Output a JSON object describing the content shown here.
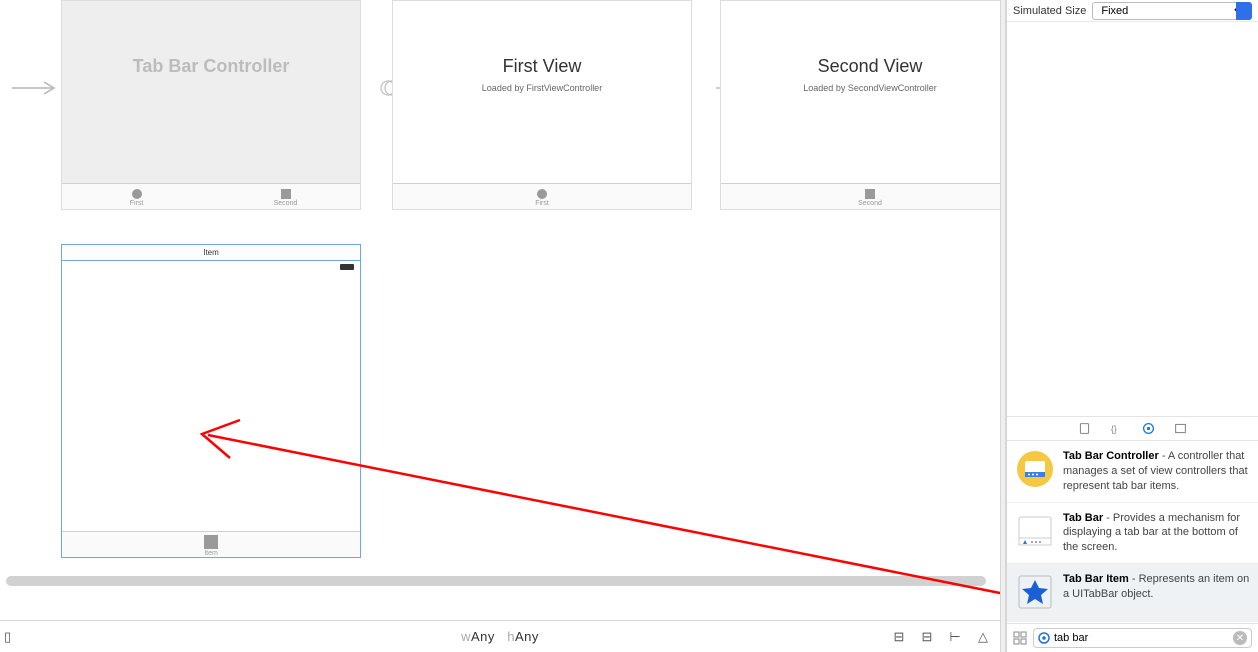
{
  "inspector": {
    "simulated_size_label": "Simulated Size",
    "simulated_size_value": "Fixed"
  },
  "library": {
    "search_value": "tab bar",
    "items": [
      {
        "title": "Tab Bar Controller",
        "desc": " - A controller that manages a set of view controllers that represent tab bar items."
      },
      {
        "title": "Tab Bar",
        "desc": " - Provides a mechanism for displaying a tab bar at the bottom of the screen."
      },
      {
        "title": "Tab Bar Item",
        "desc": " - Represents an item on a UITabBar object."
      }
    ]
  },
  "canvas": {
    "tab_bar_controller": {
      "title": "Tab Bar Controller",
      "tabs": [
        "First",
        "Second"
      ]
    },
    "first_view": {
      "title": "First View",
      "subtitle": "Loaded by FirstViewController",
      "tab": "First"
    },
    "second_view": {
      "title": "Second View",
      "subtitle": "Loaded by SecondViewController",
      "tab": "Second"
    },
    "item_scene": {
      "header": "Item",
      "tab": "Item"
    }
  },
  "bottom": {
    "w_prefix": "w",
    "w_value": "Any",
    "h_prefix": "h",
    "h_value": "Any"
  }
}
